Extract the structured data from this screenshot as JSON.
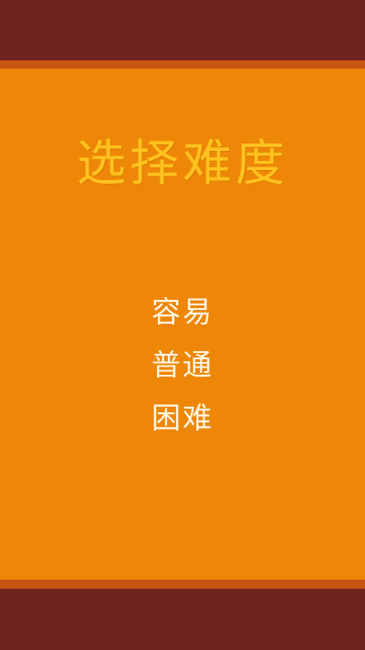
{
  "screen": {
    "title": "选择难度",
    "colors": {
      "frame": "#6e2420",
      "stripe": "#c75412",
      "panel": "#ee8707",
      "title": "#ffc21e",
      "menu_text": "#fff6e4"
    }
  },
  "difficulty_menu": {
    "items": [
      {
        "label": "容易"
      },
      {
        "label": "普通"
      },
      {
        "label": "困难"
      }
    ]
  }
}
